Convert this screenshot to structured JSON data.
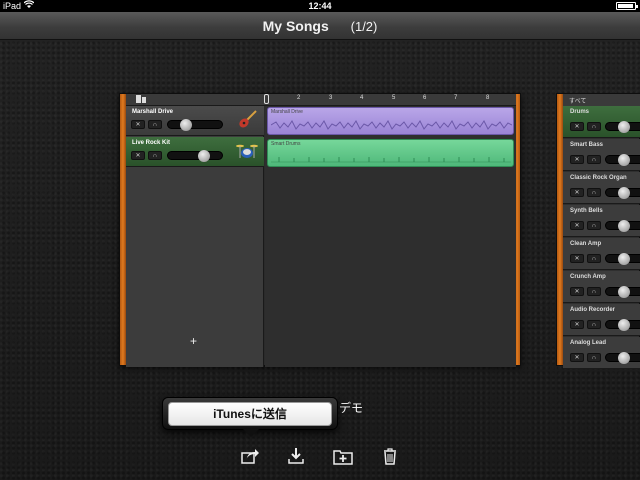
{
  "status_bar": {
    "device": "iPad",
    "time": "12:44"
  },
  "nav": {
    "title": "My Songs",
    "count": "(1/2)"
  },
  "song_card": {
    "ruler_ticks": [
      "2",
      "3",
      "4",
      "5",
      "6",
      "7",
      "8"
    ],
    "tracks": [
      {
        "name": "Marshall Drive",
        "region_name": "Marshall Drive"
      },
      {
        "name": "Live Rock Kit",
        "region_name": "Smart Drums"
      }
    ],
    "add_track_label": "+"
  },
  "side_panel": {
    "header": "すべて",
    "instruments": [
      "Drums",
      "Smart Bass",
      "Classic Rock Organ",
      "Synth Bells",
      "Clean Amp",
      "Crunch Amp",
      "Audio Recorder",
      "Analog Lead"
    ]
  },
  "popover": {
    "send_itunes_label": "iTunesに送信"
  },
  "song_title_partial": "デモ",
  "toolbar": {
    "icons": [
      "share-icon",
      "download-icon",
      "add-folder-icon",
      "trash-icon"
    ]
  },
  "colors": {
    "accent_orange": "#e07a1f",
    "track_green": "#3e6e3e",
    "region_purple": "#b9a6e8",
    "region_green": "#76d79a"
  }
}
